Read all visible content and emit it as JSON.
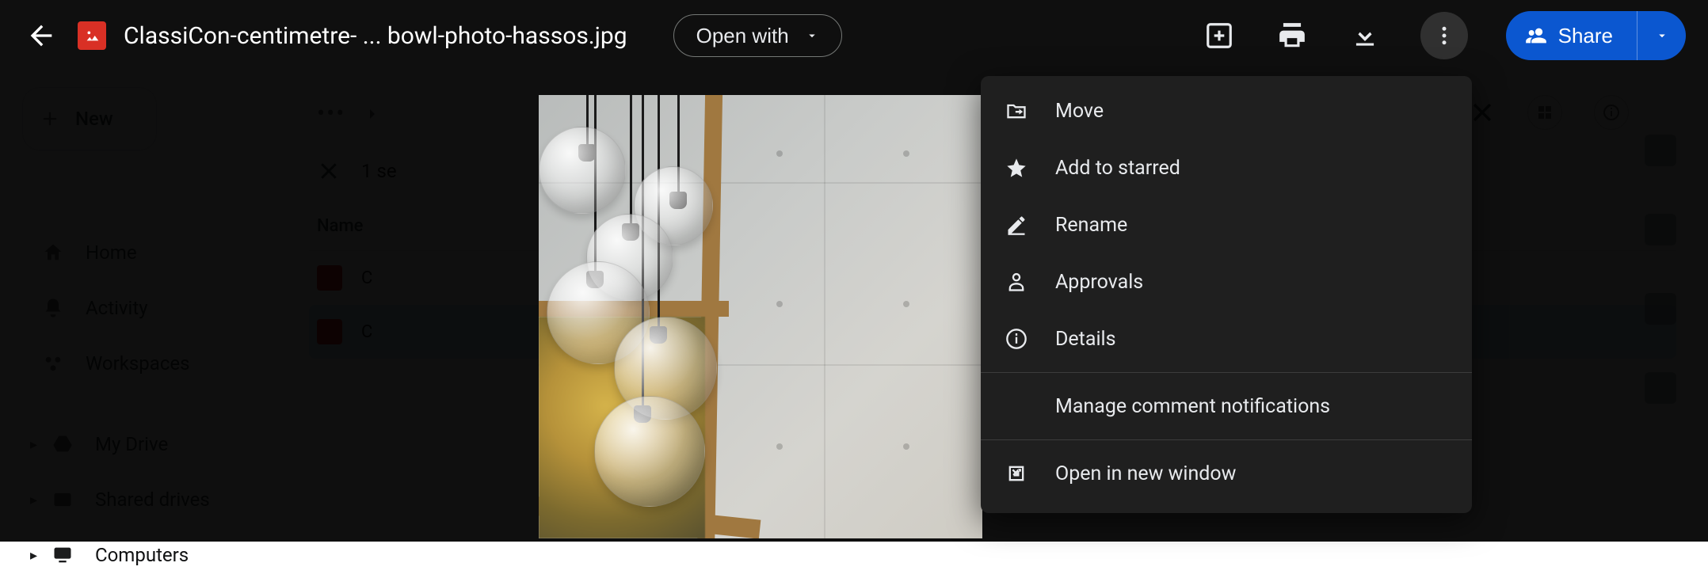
{
  "header": {
    "filename": "ClassiCon-centimetre- ... bowl-photo-hassos.jpg",
    "open_with_label": "Open with",
    "share_label": "Share"
  },
  "context_menu": {
    "move": "Move",
    "star": "Add to starred",
    "rename": "Rename",
    "approvals": "Approvals",
    "details": "Details",
    "manage_comments": "Manage comment notifications",
    "open_new_window": "Open in new window"
  },
  "drive": {
    "new_label": "New",
    "sidebar": {
      "home": "Home",
      "activity": "Activity",
      "workspaces": "Workspaces",
      "my_drive": "My Drive",
      "shared_drives": "Shared drives",
      "computers": "Computers"
    },
    "selection_text": "1 se",
    "name_col": "Name",
    "file_a_prefix": "C",
    "file_b_prefix": "C"
  }
}
